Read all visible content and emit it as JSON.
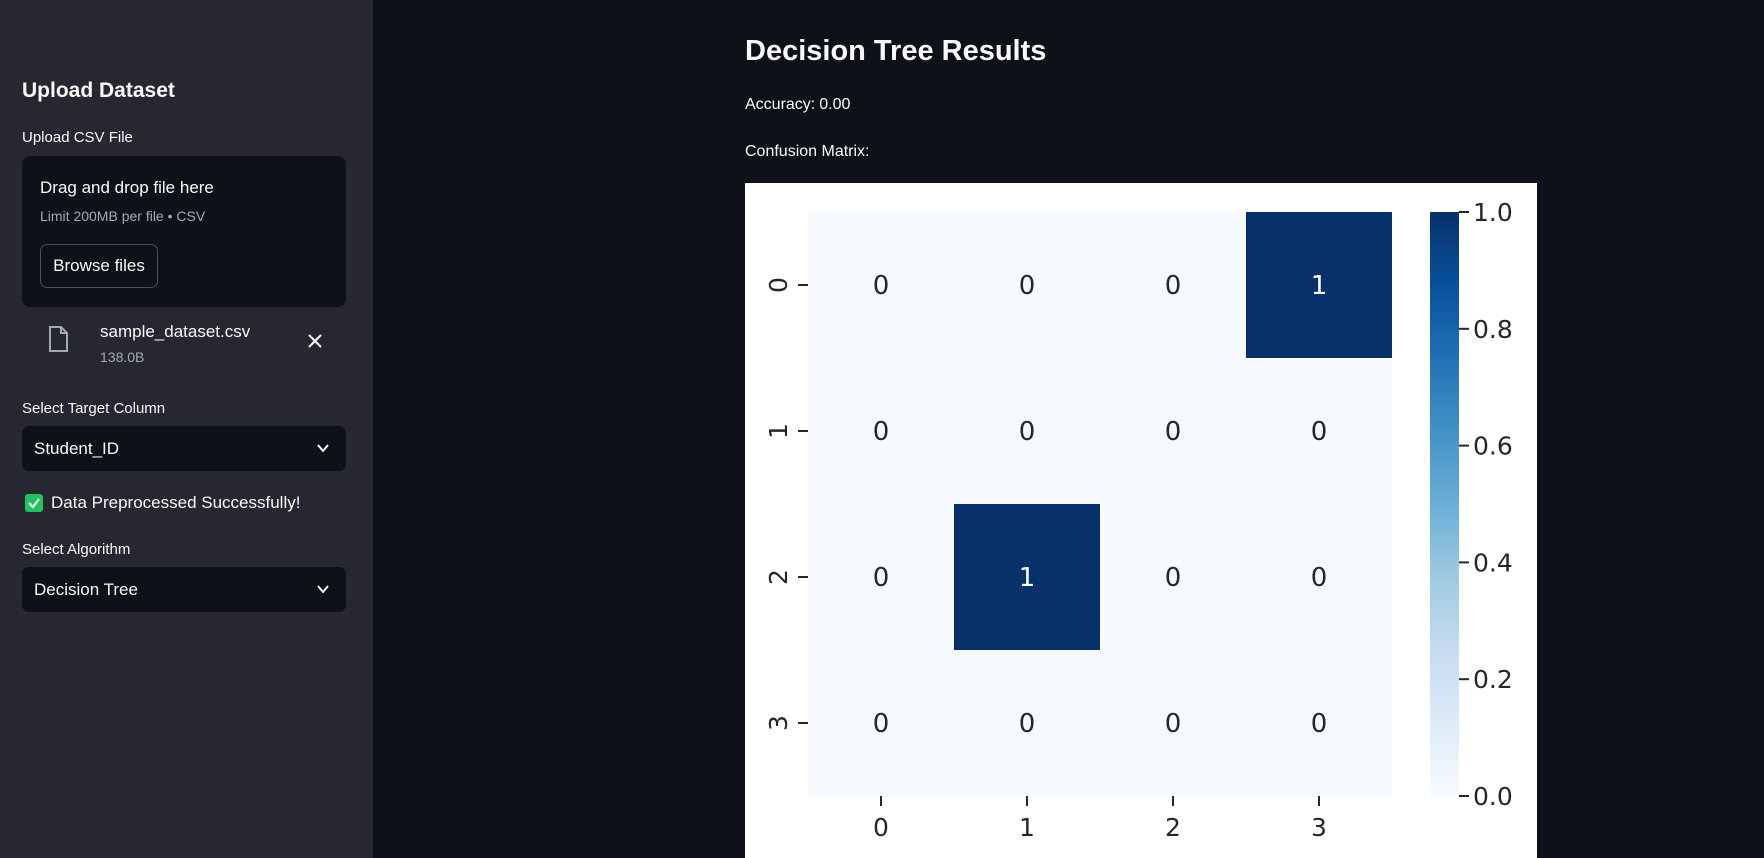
{
  "sidebar": {
    "title": "Upload Dataset",
    "upload_label": "Upload CSV File",
    "dropzone": {
      "instruction": "Drag and drop file here",
      "limit": "Limit 200MB per file • CSV",
      "browse_label": "Browse files"
    },
    "uploaded_file": {
      "name": "sample_dataset.csv",
      "size": "138.0B"
    },
    "target_label": "Select Target Column",
    "target_value": "Student_ID",
    "success_message": "Data Preprocessed Successfully!",
    "algorithm_label": "Select Algorithm",
    "algorithm_value": "Decision Tree"
  },
  "main": {
    "title": "Decision Tree Results",
    "accuracy_label": "Accuracy:",
    "accuracy_value": "0.00",
    "matrix_label": "Confusion Matrix:"
  },
  "colors": {
    "success": "#21c35e",
    "cmap_low": "#f7fbff",
    "cmap_high": "#08306b"
  },
  "chart_data": {
    "type": "heatmap",
    "x_categories": [
      "0",
      "1",
      "2",
      "3"
    ],
    "y_categories": [
      "0",
      "1",
      "2",
      "3"
    ],
    "values": [
      [
        0,
        0,
        0,
        1
      ],
      [
        0,
        0,
        0,
        0
      ],
      [
        0,
        1,
        0,
        0
      ],
      [
        0,
        0,
        0,
        0
      ]
    ],
    "annotations": true,
    "colormap": "Blues",
    "colorbar": {
      "range": [
        0,
        1
      ],
      "ticks": [
        "0.0",
        "0.2",
        "0.4",
        "0.6",
        "0.8",
        "1.0"
      ]
    }
  }
}
